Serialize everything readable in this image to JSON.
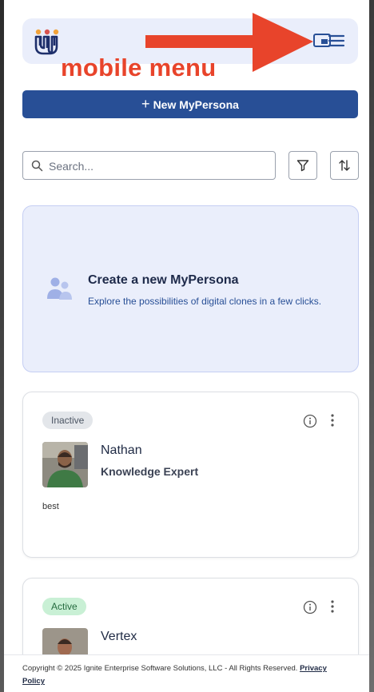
{
  "annotation": {
    "text": "mobile menu",
    "color": "#e8442b"
  },
  "header": {
    "logo": "logo-icon",
    "icons": [
      "screen-icon",
      "menu-icon"
    ]
  },
  "toolbar": {
    "new_button_label": "New MyPersona",
    "new_button_icon": "plus-icon"
  },
  "search": {
    "placeholder": "Search...",
    "value": ""
  },
  "actions": {
    "filter": "filter-icon",
    "sort": "sort-icon"
  },
  "create_card": {
    "title": "Create a new MyPersona",
    "subtitle": "Explore the possibilities of digital clones in a few clicks.",
    "icon": "users-icon"
  },
  "personas": [
    {
      "status": "Inactive",
      "name": "Nathan",
      "role": "Knowledge Expert",
      "description": "best"
    },
    {
      "status": "Active",
      "name": "Vertex",
      "role": ""
    }
  ],
  "footer": {
    "copyright": "Copyright © 2025 Ignite Enterprise Software Solutions, LLC - All Rights Reserved.",
    "privacy_link": "Privacy Policy"
  },
  "colors": {
    "primary": "#284f96",
    "header_bg": "#eaeefb",
    "inactive_badge": "#e3e6ea",
    "active_badge": "#c9f0d5"
  }
}
